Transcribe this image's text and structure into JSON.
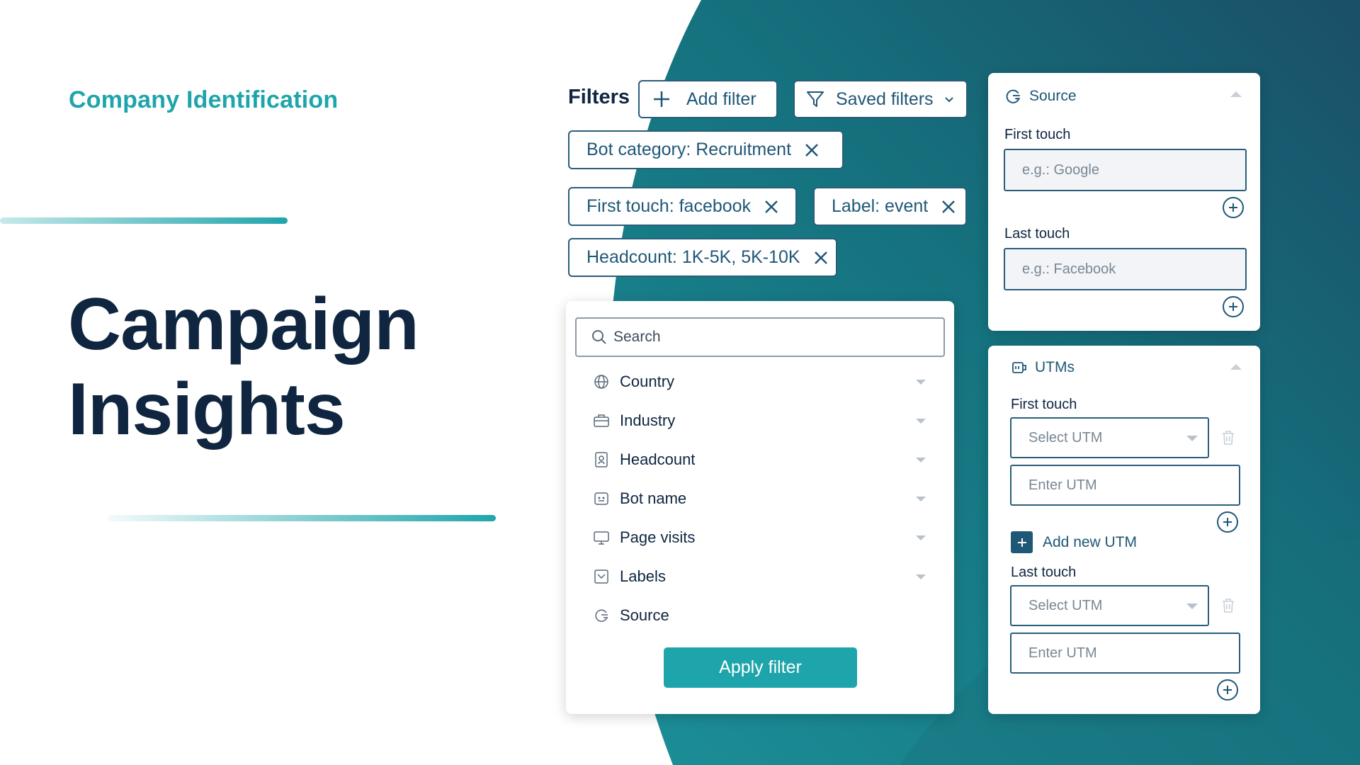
{
  "brand": {
    "eyebrow": "Company Identification",
    "hero_line1": "Campaign",
    "hero_line2": "Insights",
    "accent": "#1ea5ab",
    "navy": "#0f2540",
    "teal_bg": "#15747f"
  },
  "filters": {
    "label": "Filters",
    "add_filter": "Add filter",
    "saved_filters": "Saved filters",
    "chips": [
      "Bot category: Recruitment",
      "First touch: facebook",
      "Label: event",
      "Headcount: 1K-5K, 5K-10K"
    ]
  },
  "filter_panel": {
    "search_placeholder": "Search",
    "items": [
      {
        "label": "Country",
        "icon": "globe-icon"
      },
      {
        "label": "Industry",
        "icon": "briefcase-icon"
      },
      {
        "label": "Headcount",
        "icon": "badge-icon"
      },
      {
        "label": "Bot name",
        "icon": "bot-icon"
      },
      {
        "label": "Page visits",
        "icon": "monitor-icon"
      },
      {
        "label": "Labels",
        "icon": "label-icon"
      },
      {
        "label": "Source",
        "icon": "source-icon"
      }
    ],
    "apply": "Apply filter"
  },
  "source_card": {
    "title": "Source",
    "first_touch_label": "First touch",
    "first_touch_placeholder": "e.g.: Google",
    "last_touch_label": "Last touch",
    "last_touch_placeholder": "e.g.: Facebook"
  },
  "utm_card": {
    "title": "UTMs",
    "first_touch_label": "First touch",
    "select_placeholder": "Select UTM",
    "enter_placeholder": "Enter UTM",
    "add_new": "Add new UTM",
    "last_touch_label": "Last touch"
  }
}
